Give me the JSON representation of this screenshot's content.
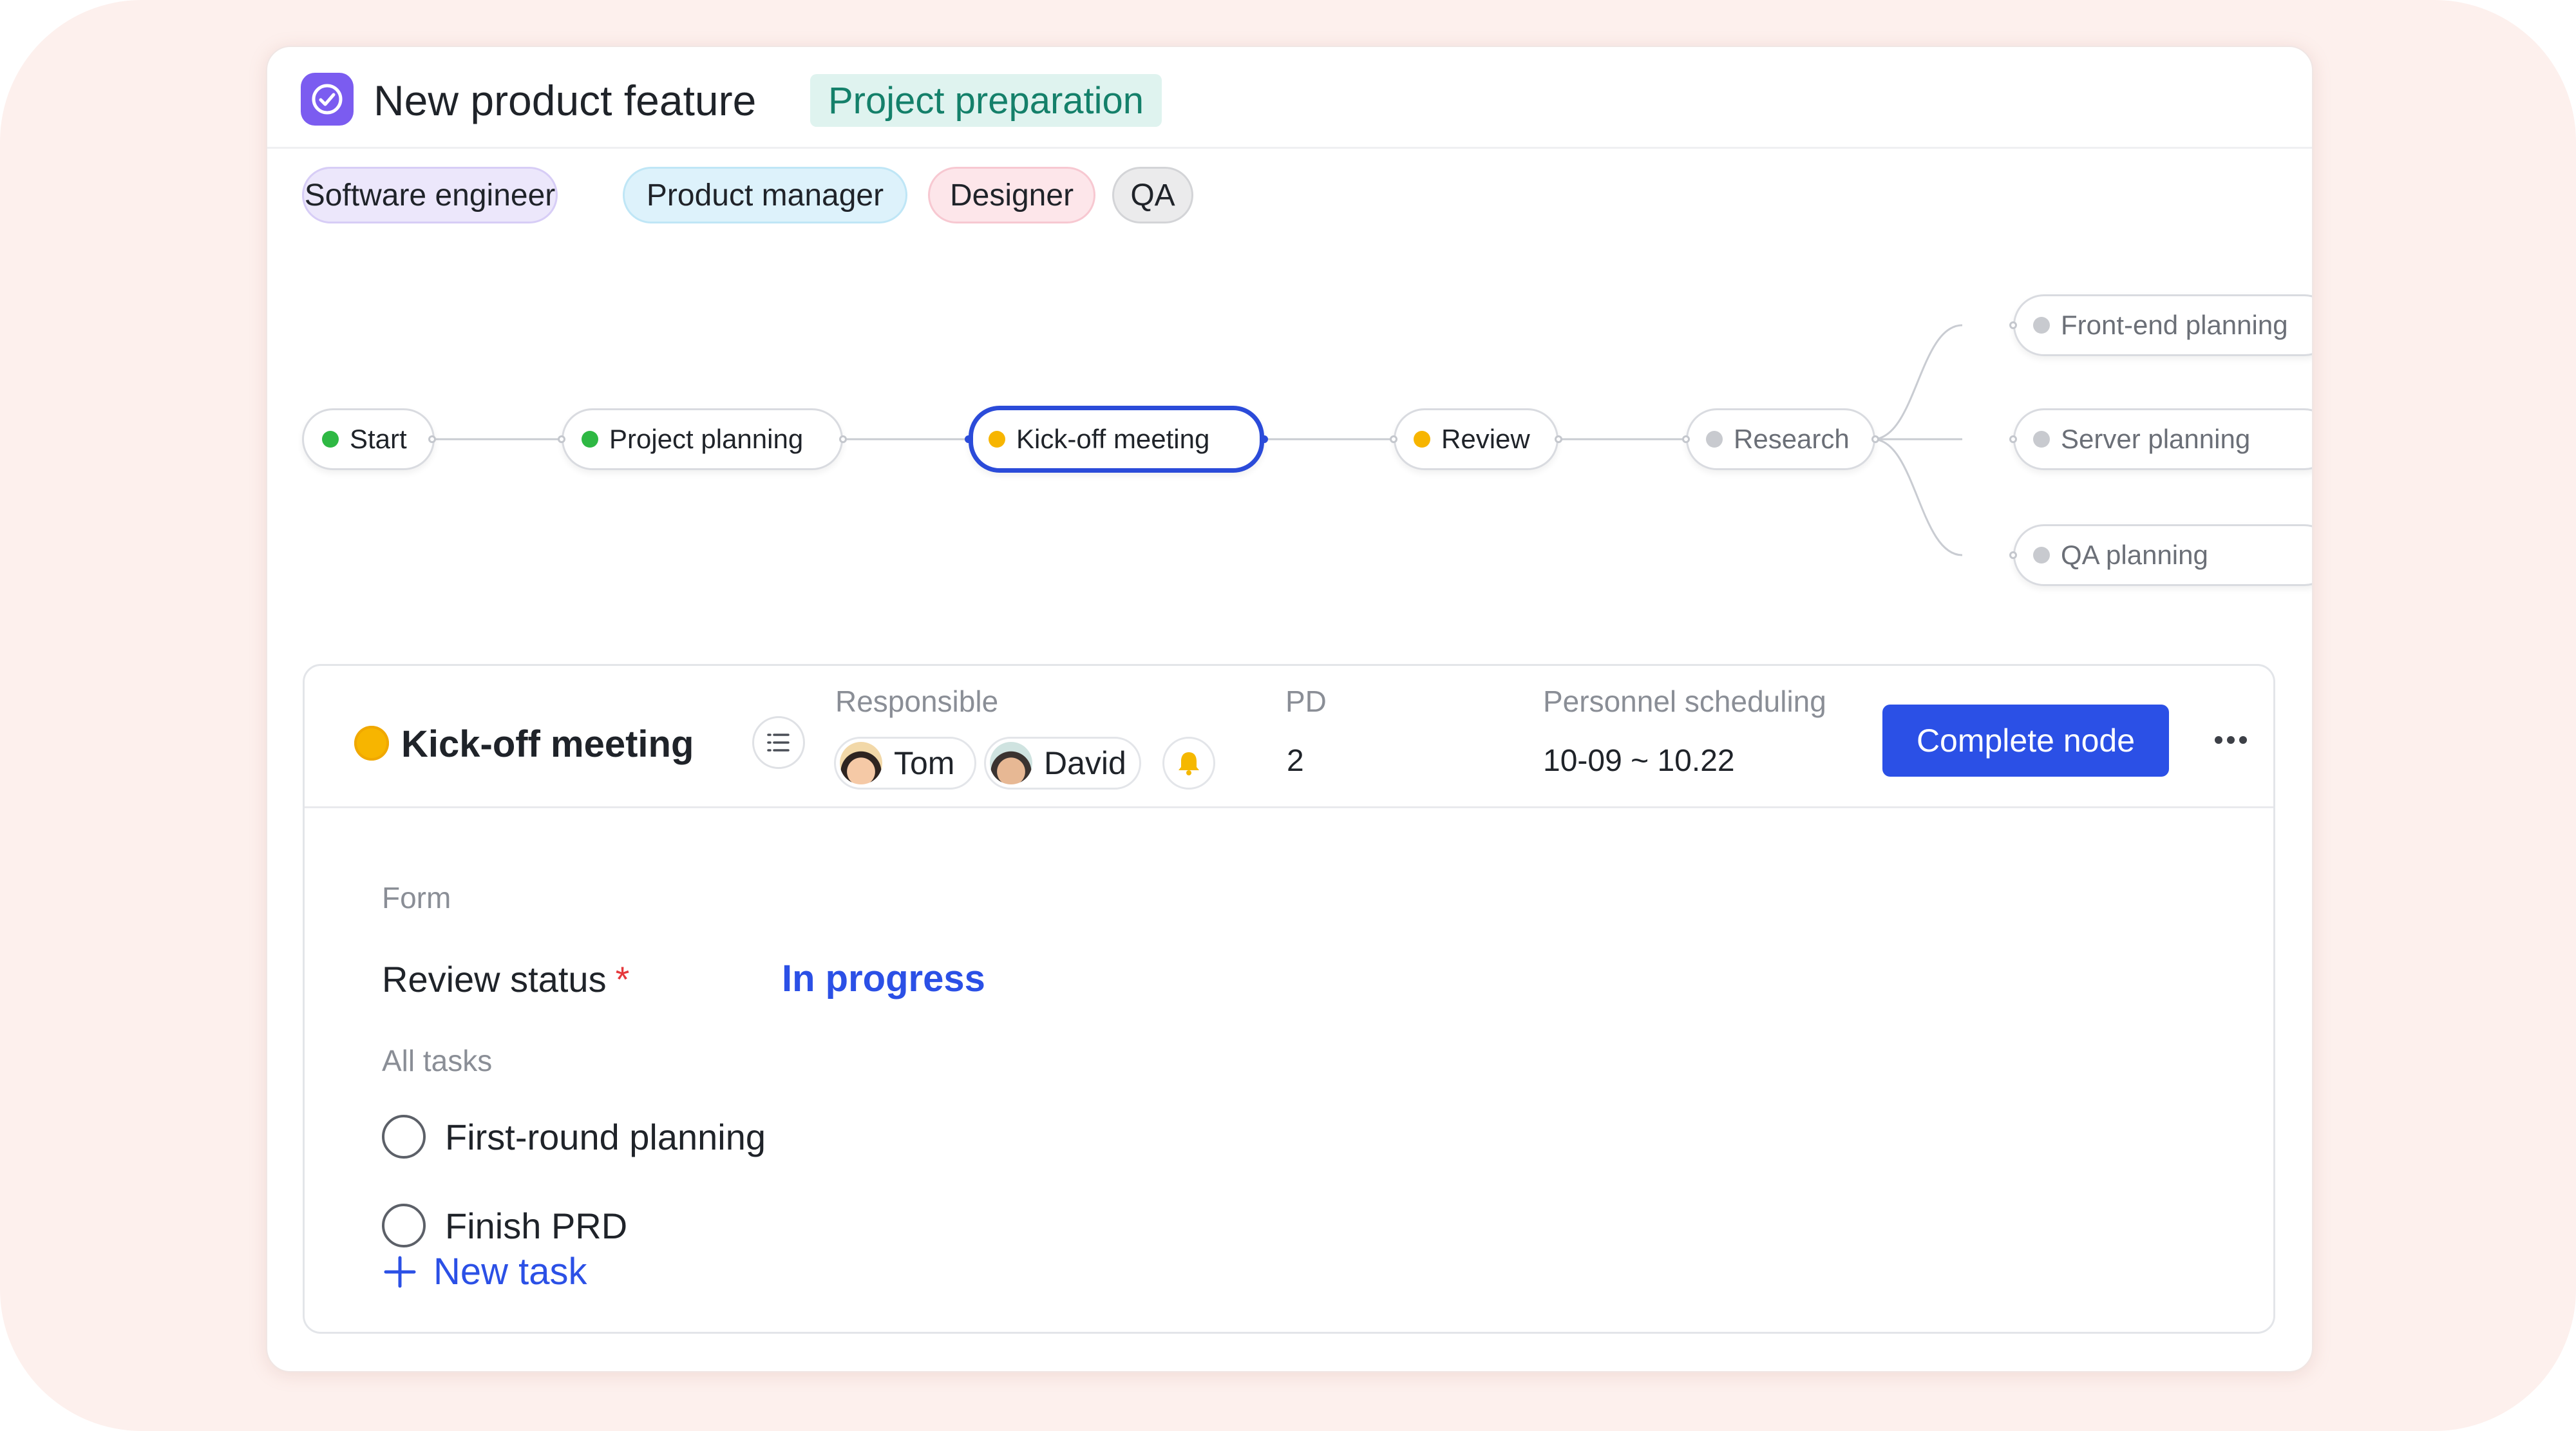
{
  "header": {
    "title": "New product feature",
    "stage": "Project preparation",
    "icon": "check-circle-icon"
  },
  "roles": [
    {
      "label": "Software engineer",
      "color": "#ece7fb"
    },
    {
      "label": "Product manager",
      "color": "#ddf2fb"
    },
    {
      "label": "Designer",
      "color": "#fde6ea"
    },
    {
      "label": "QA",
      "color": "#ebebec"
    }
  ],
  "flow": {
    "nodes": [
      {
        "label": "Start",
        "status": "completed"
      },
      {
        "label": "Project planning",
        "status": "completed"
      },
      {
        "label": "Kick-off meeting",
        "status": "in-progress",
        "selected": true
      },
      {
        "label": "Review",
        "status": "in-progress"
      },
      {
        "label": "Research",
        "status": "not-started"
      },
      {
        "label": "Front-end planning",
        "status": "not-started"
      },
      {
        "label": "Server planning",
        "status": "not-started"
      },
      {
        "label": "QA planning",
        "status": "not-started"
      }
    ],
    "status_colors": {
      "completed": "#2eb843",
      "in-progress": "#f7b500",
      "not-started": "#c8cacf"
    }
  },
  "detail": {
    "title": "Kick-off meeting",
    "responsible_label": "Responsible",
    "people": [
      "Tom",
      "David"
    ],
    "pd_label": "PD",
    "pd_value": "2",
    "scheduling_label": "Personnel scheduling",
    "scheduling_value": "10-09 ~ 10.22",
    "complete_button": "Complete node",
    "form_label": "Form",
    "review_status_label": "Review status",
    "required_mark": "*",
    "review_status_value": "In progress",
    "all_tasks_label": "All tasks",
    "tasks": [
      {
        "label": "First-round planning",
        "done": false
      },
      {
        "label": "Finish PRD",
        "done": false
      }
    ],
    "new_task_label": "New task"
  },
  "colors": {
    "accent": "#2b50e6",
    "backdrop": "#fdf0ed",
    "stage_tag": "#14806a"
  }
}
